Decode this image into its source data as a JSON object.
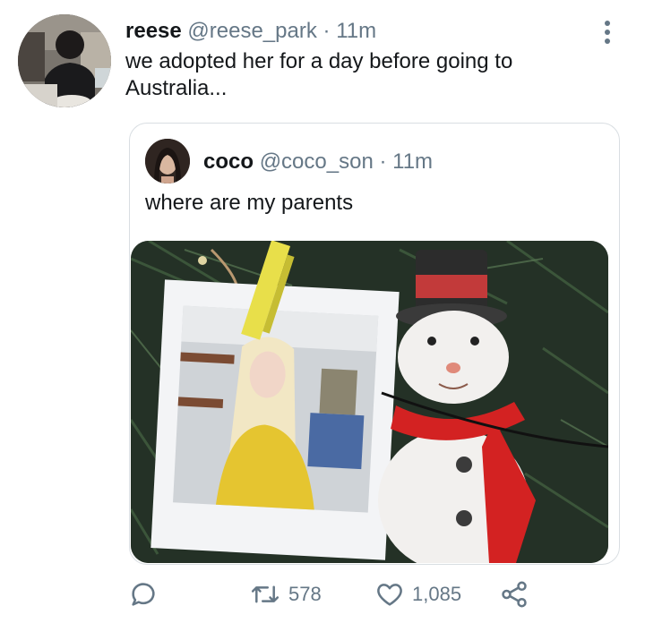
{
  "tweet": {
    "display_name": "reese",
    "handle": "@reese_park",
    "separator": "·",
    "time": "11m",
    "text": "we adopted her for a day before going to Australia...",
    "more_icon": "more-vertical-icon"
  },
  "quoted": {
    "display_name": "coco",
    "handle": "@coco_son",
    "separator": "·",
    "time": "11m",
    "text": "where are my parents",
    "image_alt": "polaroid photo clipped to christmas tree next to snowman ornament"
  },
  "actions": {
    "reply_icon": "reply-icon",
    "retweet_icon": "retweet-icon",
    "retweet_count": "578",
    "like_icon": "heart-icon",
    "like_count": "1,085",
    "share_icon": "share-icon"
  },
  "colors": {
    "text": "#14171a",
    "muted": "#657786",
    "border": "#d9dee2"
  }
}
